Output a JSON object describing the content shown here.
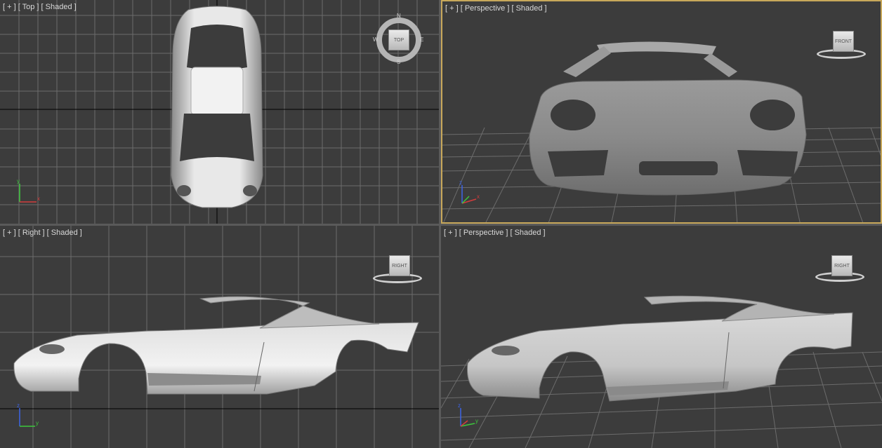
{
  "viewports": [
    {
      "id": "top",
      "label": "[ + ] [ Top ] [ Shaded ]",
      "cube": "TOP",
      "compass": [
        "N",
        "E",
        "S",
        "W"
      ]
    },
    {
      "id": "persp1",
      "label": "[ + ] [ Perspective ] [ Shaded ]",
      "cube": "FRONT",
      "active": true
    },
    {
      "id": "right",
      "label": "[ + ] [ Right ] [ Shaded ]",
      "cube": "RIGHT"
    },
    {
      "id": "persp2",
      "label": "[ + ] [ Perspective ] [ Shaded ]",
      "cube": "RIGHT"
    }
  ],
  "axes": {
    "x": "x",
    "y": "y",
    "z": "z"
  },
  "colors": {
    "grid": "#6c6c6c",
    "grid_main": "#000000",
    "x_axis": "#d23c3c",
    "y_axis": "#3cc83c",
    "z_axis": "#3c64e6",
    "active_border": "#c8a85a"
  }
}
